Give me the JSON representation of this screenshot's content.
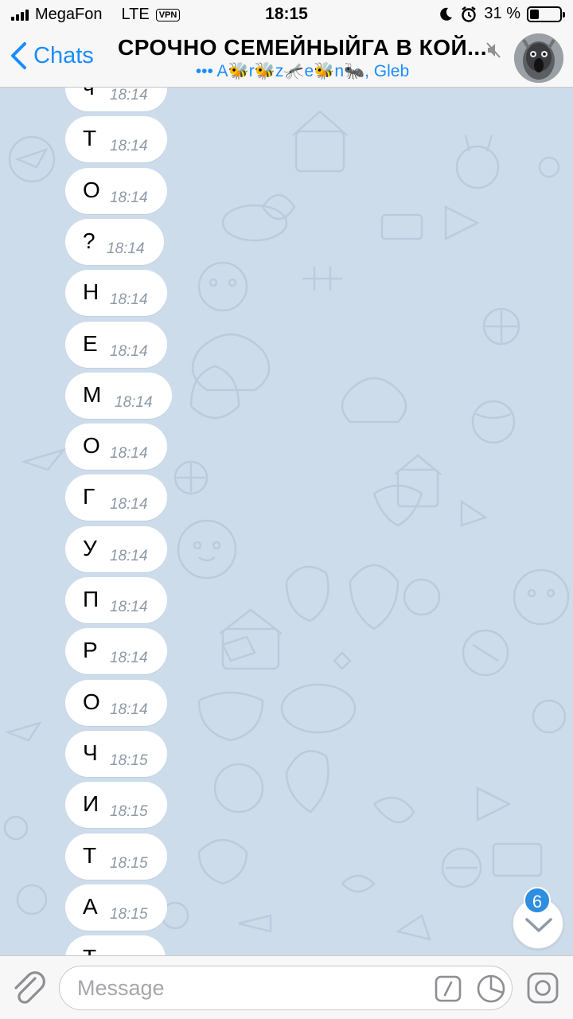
{
  "status_bar": {
    "carrier": "MegaFon",
    "network": "LTE",
    "vpn": "VPN",
    "time": "18:15",
    "battery": "31 %",
    "battery_level": 0.31
  },
  "nav": {
    "back_label": "Chats",
    "title": "СРОЧНО СЕМЕЙНЫЙГА В КОЙ...",
    "subtitle": "••• A🐝r🐝z🦟e🐝n🐜, Gleb"
  },
  "messages": [
    {
      "text": "ч",
      "time": "18:14"
    },
    {
      "text": "Т",
      "time": "18:14"
    },
    {
      "text": "О",
      "time": "18:14"
    },
    {
      "text": "?",
      "time": "18:14"
    },
    {
      "text": "Н",
      "time": "18:14"
    },
    {
      "text": "Е",
      "time": "18:14"
    },
    {
      "text": "М",
      "time": "18:14"
    },
    {
      "text": "О",
      "time": "18:14"
    },
    {
      "text": "Г",
      "time": "18:14"
    },
    {
      "text": "У",
      "time": "18:14"
    },
    {
      "text": "П",
      "time": "18:14"
    },
    {
      "text": "Р",
      "time": "18:14"
    },
    {
      "text": "О",
      "time": "18:14"
    },
    {
      "text": "Ч",
      "time": "18:15"
    },
    {
      "text": "И",
      "time": "18:15"
    },
    {
      "text": "Т",
      "time": "18:15"
    },
    {
      "text": "А",
      "time": "18:15"
    },
    {
      "text": "Т",
      "time": ""
    }
  ],
  "scroll": {
    "unread_count": "6"
  },
  "input": {
    "placeholder": "Message"
  },
  "colors": {
    "accent": "#1a8cff",
    "wallpaper": "#cddceb",
    "bubble": "#ffffff",
    "badge": "#2e8ee0"
  }
}
